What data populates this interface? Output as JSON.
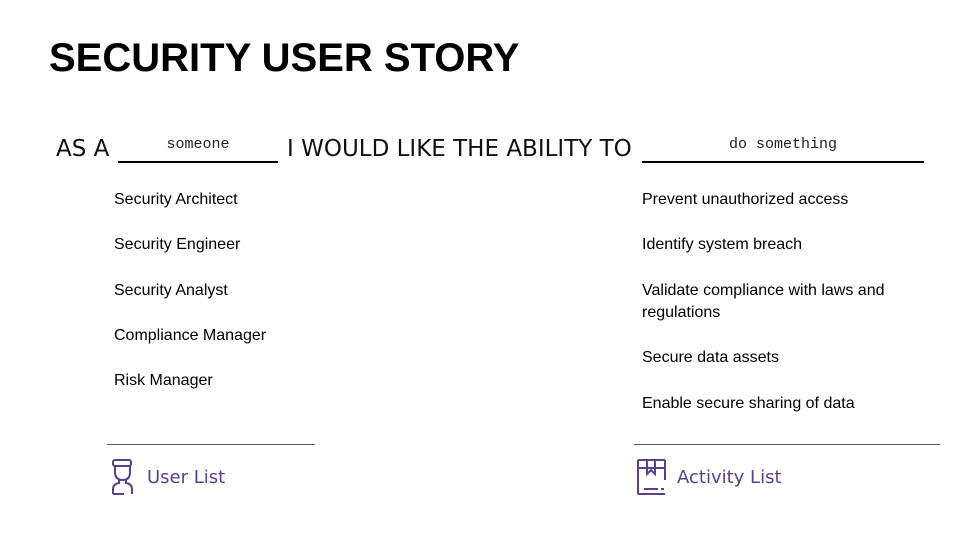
{
  "header": {
    "title": "SECURITY USER STORY"
  },
  "story": {
    "prefix": "AS A",
    "role_placeholder": "someone",
    "middle": "I WOULD LIKE THE ABILITY TO",
    "action_placeholder": "do something"
  },
  "users": {
    "items": [
      "Security Architect",
      "Security Engineer",
      "Security Analyst",
      "Compliance Manager",
      "Risk Manager"
    ],
    "footer_label": "User List",
    "footer_icon": "user-icon"
  },
  "activities": {
    "items": [
      "Prevent unauthorized access",
      "Identify system breach",
      "Validate compliance with laws and",
      "regulations",
      "Secure data assets",
      "Enable secure sharing of data"
    ],
    "footer_label": "Activity List",
    "footer_icon": "box-icon"
  },
  "colors": {
    "accent": "#5b3f8a",
    "divider": "#5a5070"
  }
}
